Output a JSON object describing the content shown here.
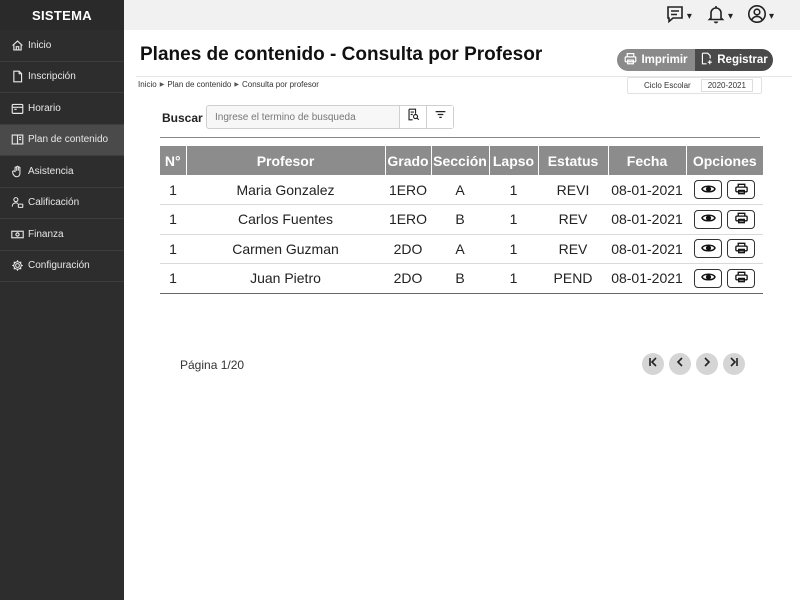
{
  "brand": "SISTEMA",
  "sidebar": {
    "items": [
      {
        "label": "Inicio",
        "icon": "home-icon"
      },
      {
        "label": "Inscripción",
        "icon": "document-icon"
      },
      {
        "label": "Horario",
        "icon": "calendar-icon"
      },
      {
        "label": "Plan de contenido",
        "icon": "book-icon",
        "active": true
      },
      {
        "label": "Asistencia",
        "icon": "hand-icon"
      },
      {
        "label": "Calificación",
        "icon": "user-grade-icon"
      },
      {
        "label": "Finanza",
        "icon": "money-icon"
      },
      {
        "label": "Configuración",
        "icon": "gear-icon"
      }
    ]
  },
  "topbar": {
    "icons": [
      "message-icon",
      "bell-icon",
      "user-circle-icon"
    ],
    "caret": "▾"
  },
  "page": {
    "title": "Planes de contenido - Consulta por Profesor"
  },
  "actions": {
    "print_label": "Imprimir",
    "register_label": "Registrar"
  },
  "breadcrumb": [
    "Inicio",
    "Plan de contenido",
    "Consulta por profesor"
  ],
  "cycle": {
    "label": "Ciclo Escolar",
    "value": "2020-2021"
  },
  "search": {
    "label": "Buscar",
    "placeholder": "Ingrese el termino de busqueda"
  },
  "table": {
    "headers": [
      "N°",
      "Profesor",
      "Grado",
      "Sección",
      "Lapso",
      "Estatus",
      "Fecha",
      "Opciones"
    ],
    "rows": [
      [
        "1",
        "Maria Gonzalez",
        "1ERO",
        "A",
        "1",
        "REVI",
        "08-01-2021"
      ],
      [
        "1",
        "Carlos Fuentes",
        "1ERO",
        "B",
        "1",
        "REV",
        "08-01-2021"
      ],
      [
        "1",
        "Carmen Guzman",
        "2DO",
        "A",
        "1",
        "REV",
        "08-01-2021"
      ],
      [
        "1",
        "Juan Pietro",
        "2DO",
        "B",
        "1",
        "PEND",
        "08-01-2021"
      ]
    ]
  },
  "pagination": {
    "text": "Página 1/20"
  }
}
